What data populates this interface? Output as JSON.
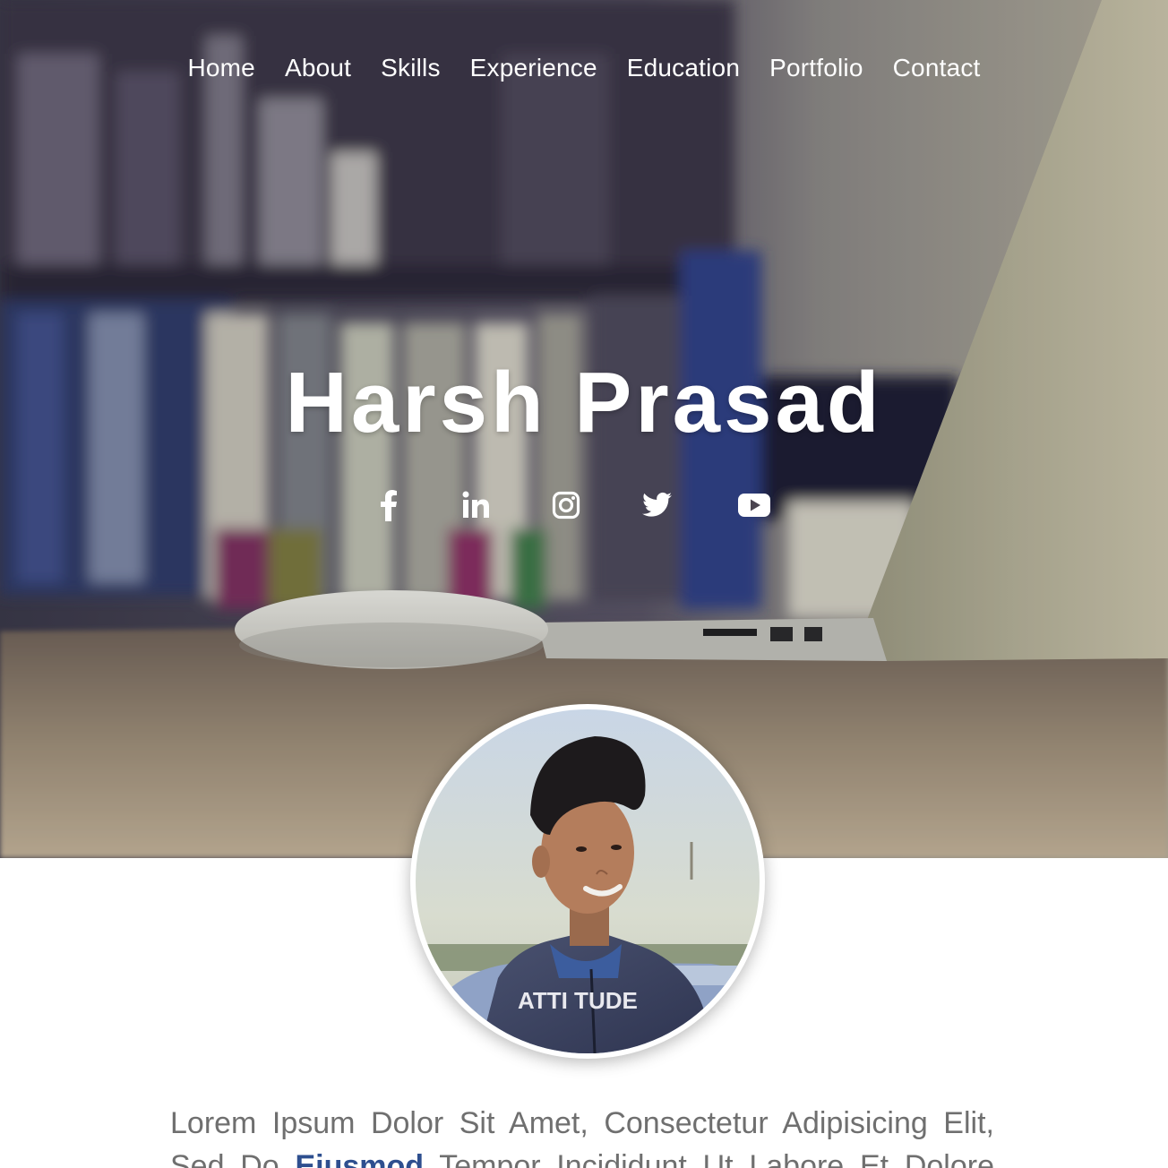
{
  "nav": {
    "items": [
      "Home",
      "About",
      "Skills",
      "Experience",
      "Education",
      "Portfolio",
      "Contact"
    ]
  },
  "hero": {
    "name": "Harsh Prasad"
  },
  "social": [
    {
      "icon": "facebook-icon"
    },
    {
      "icon": "linkedin-icon"
    },
    {
      "icon": "instagram-icon"
    },
    {
      "icon": "twitter-icon"
    },
    {
      "icon": "youtube-icon"
    }
  ],
  "avatar": {
    "shirt_text": "ATTI TUDE"
  },
  "about": {
    "line1": "Lorem Ipsum Dolor Sit Amet, Consectetur Adipisicing Elit,",
    "line2_start": "Sed Do",
    "line2_highlight": "Eiusmod",
    "line2_end": "Tempor Incididunt Ut Labore Et Dolore"
  },
  "colors": {
    "accent": "#2e4f8f",
    "text": "#6f6f6f",
    "nav_text": "#ffffff"
  }
}
